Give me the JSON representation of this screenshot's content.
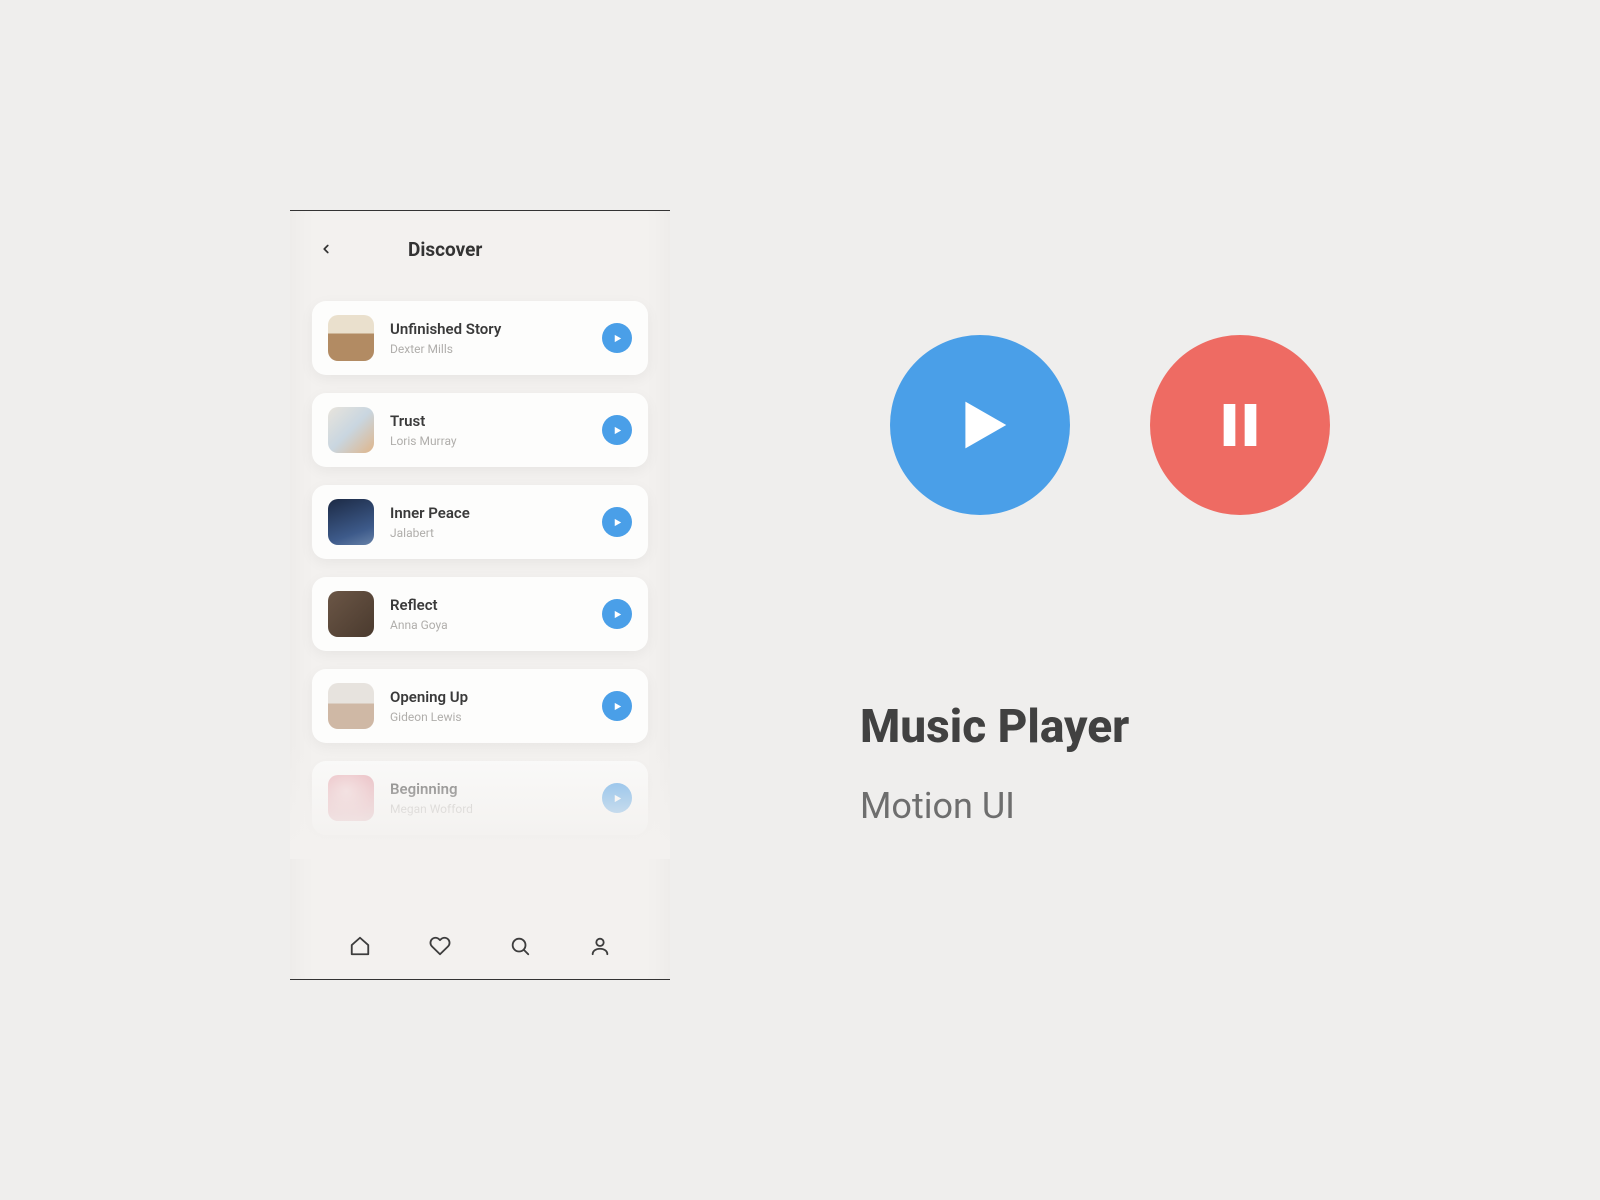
{
  "phone": {
    "header_title": "Discover",
    "tracks": [
      {
        "title": "Unfinished Story",
        "artist": "Dexter Mills"
      },
      {
        "title": "Trust",
        "artist": "Loris Murray"
      },
      {
        "title": "Inner Peace",
        "artist": "Jalabert"
      },
      {
        "title": "Reflect",
        "artist": "Anna Goya"
      },
      {
        "title": "Opening Up",
        "artist": "Gideon Lewis"
      },
      {
        "title": "Beginning",
        "artist": "Megan Wofford"
      }
    ],
    "tabs": [
      "home",
      "favorites",
      "search",
      "profile"
    ]
  },
  "promo": {
    "heading": "Music Player",
    "subheading": "Motion UI"
  },
  "colors": {
    "play_button": "#4a9fe8",
    "pause_button": "#ee6b63"
  }
}
